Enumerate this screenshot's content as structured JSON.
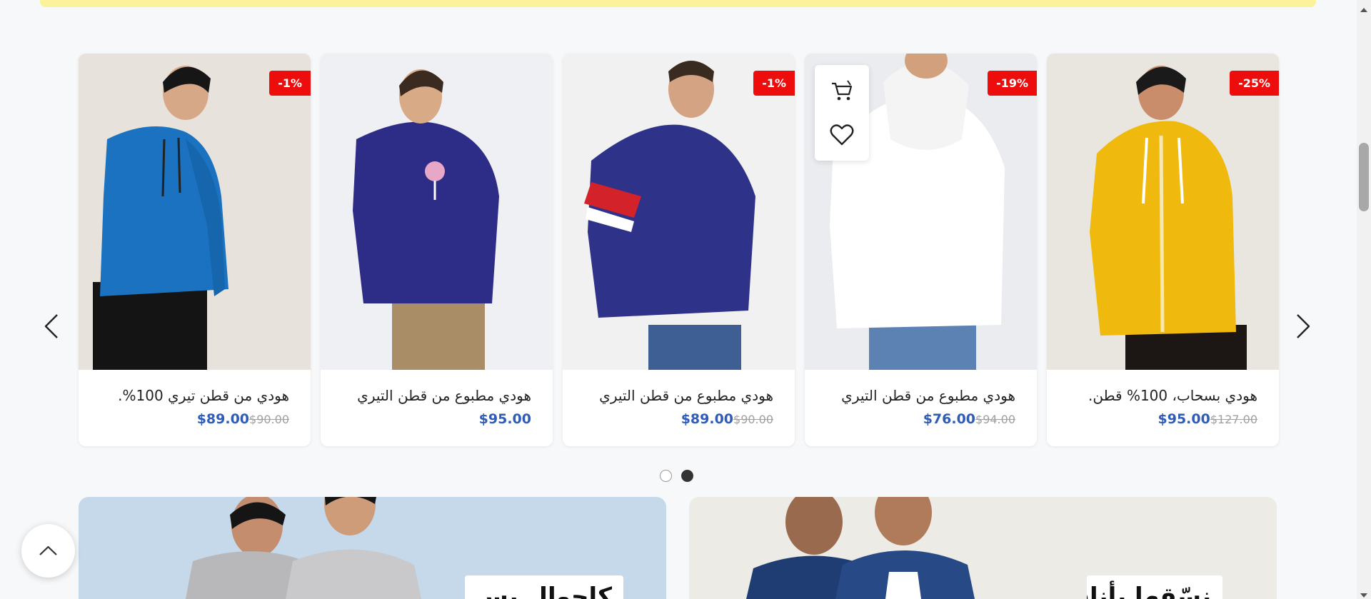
{
  "products": [
    {
      "name": "هودي بسحاب، 100% قطن.",
      "price": "$95.00",
      "old_price": "$127.00",
      "badge": "-25%",
      "image_icon": "yellow-hoodie-photo"
    },
    {
      "name": "هودي مطبوع من قطن التيري",
      "price": "$76.00",
      "old_price": "$94.00",
      "badge": "-19%",
      "image_icon": "white-hoodie-photo"
    },
    {
      "name": "هودي مطبوع من قطن التيري",
      "price": "$89.00",
      "old_price": "$90.00",
      "badge": "-1%",
      "image_icon": "navy-striped-hoodie-photo"
    },
    {
      "name": "هودي مطبوع من قطن التيري",
      "price": "$95.00",
      "old_price": "",
      "badge": "",
      "image_icon": "navy-print-hoodie-photo"
    },
    {
      "name": "هودي من قطن تيري 100%.",
      "price": "$89.00",
      "old_price": "$90.00",
      "badge": "-1%",
      "image_icon": "blue-hoodie-photo"
    }
  ],
  "carousel": {
    "prev_icon": "chevron-left-icon",
    "next_icon": "chevron-right-icon",
    "pages": 2,
    "active_page": 2
  },
  "hover_actions": {
    "cart_icon": "shopping-cart-icon",
    "wishlist_icon": "heart-icon"
  },
  "banners": {
    "left_label": "كاجوال بس مرتب",
    "right_label": "نسّقها بأناقة"
  },
  "back_to_top_icon": "chevron-up-icon",
  "colors": {
    "badge": "#ee0d0d",
    "price": "#2f5cb8",
    "top_strip": "#fbf29a"
  }
}
